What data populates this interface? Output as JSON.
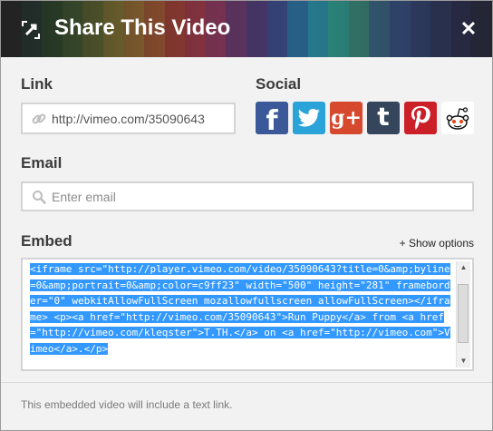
{
  "header": {
    "title": "Share This Video",
    "close_label": "✕",
    "stripe_colors": [
      "#3a3a3a",
      "#2d5e4e",
      "#3e7a3a",
      "#5f8f3a",
      "#8a9a38",
      "#b9a33a",
      "#d08f38",
      "#cf6a37",
      "#c3473a",
      "#b63b4f",
      "#9a3a64",
      "#6e3a72",
      "#503c78",
      "#3b4a86",
      "#2d6a96",
      "#2b8aa0",
      "#2f9a8e",
      "#3a8a7a",
      "#3a6a88",
      "#38558a",
      "#354a7c",
      "#333f6c",
      "#2f3458",
      "#2b2d44"
    ]
  },
  "link": {
    "label": "Link",
    "value": "http://vimeo.com/35090643"
  },
  "social": {
    "label": "Social",
    "buttons": [
      {
        "name": "facebook",
        "glyph": "f",
        "color": "#3b5998"
      },
      {
        "name": "twitter",
        "glyph": "t",
        "color": "#2aa3d8"
      },
      {
        "name": "google-plus",
        "glyph": "g+",
        "color": "#d6492f"
      },
      {
        "name": "tumblr",
        "glyph": "t",
        "color": "#35465c"
      },
      {
        "name": "pinterest",
        "glyph": "P",
        "color": "#cb2027"
      },
      {
        "name": "reddit",
        "glyph": "",
        "color": "#ffffff"
      }
    ]
  },
  "email": {
    "label": "Email",
    "placeholder": "Enter email"
  },
  "embed": {
    "label": "Embed",
    "show_options": "+ Show options",
    "code": "<iframe src=\"http://player.vimeo.com/video/35090643?title=0&amp;byline=0&amp;portrait=0&amp;color=c9ff23\" width=\"500\" height=\"281\" frameborder=\"0\" webkitAllowFullScreen mozallowfullscreen allowFullScreen></iframe> <p><a href=\"http://vimeo.com/35090643\">Run Puppy</a> from <a href=\"http://vimeo.com/kleqster\">T.TH.</a> on <a href=\"http://vimeo.com\">Vimeo</a>.</p>"
  },
  "footer": {
    "note": "This embedded video will include a text link."
  }
}
